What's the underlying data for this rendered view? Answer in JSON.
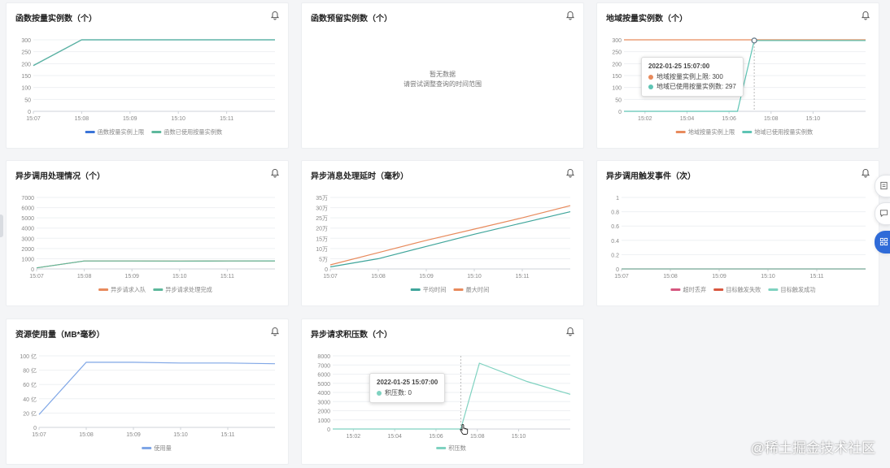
{
  "common": {
    "bell_icon": "bell-icon"
  },
  "side_toolbar": {
    "icons": [
      "document-icon",
      "chat-icon",
      "grid-icon"
    ]
  },
  "watermark": "@稀土掘金技术社区",
  "cards": [
    {
      "title": "函数按量实例数（个）",
      "chart_data": {
        "type": "line",
        "y_ticks": [
          "0",
          "50",
          "100",
          "150",
          "200",
          "250",
          "300"
        ],
        "ylim": [
          0,
          300
        ],
        "x_ticks": [
          "15:07",
          "15:08",
          "15:09",
          "15:10",
          "15:11"
        ],
        "x_tick_pos": [
          0,
          1,
          2,
          3,
          4
        ],
        "xlim": [
          0,
          5
        ],
        "series": [
          {
            "name": "函数按量实例上限",
            "color": "#3a74d8",
            "x": [
              0,
              1,
              2,
              3,
              4,
              5
            ],
            "y": [
              192,
              300,
              300,
              300,
              300,
              300
            ]
          },
          {
            "name": "函数已使用按量实例数",
            "color": "#5db89c",
            "x": [
              0,
              1,
              2,
              3,
              4,
              5
            ],
            "y": [
              192,
              300,
              300,
              300,
              300,
              300
            ]
          }
        ]
      }
    },
    {
      "title": "函数预留实例数（个）",
      "empty_line1": "暂无数据",
      "empty_line2": "请尝试调整查询的时间范围"
    },
    {
      "title": "地域按量实例数（个）",
      "chart_data": {
        "type": "line",
        "y_ticks": [
          "0",
          "50",
          "100",
          "150",
          "200",
          "250",
          "300"
        ],
        "ylim": [
          0,
          300
        ],
        "x_ticks": [
          "15:02",
          "15:04",
          "15:06",
          "15:08",
          "15:10"
        ],
        "x_tick_pos": [
          1,
          3,
          5,
          7,
          9
        ],
        "xlim": [
          0,
          11.5
        ],
        "hover_x": 6.2,
        "series": [
          {
            "name": "地域按量实例上限",
            "color": "#e88a5c",
            "x": [
              0,
              6.2,
              11.5
            ],
            "y": [
              300,
              300,
              300
            ]
          },
          {
            "name": "地域已使用按量实例数",
            "color": "#5ec4b4",
            "x": [
              0,
              5.2,
              5.4,
              6.2,
              11.5
            ],
            "y": [
              0,
              0,
              0,
              297,
              297
            ]
          }
        ]
      },
      "tooltip": {
        "title": "2022-01-25 15:07:00",
        "rows": [
          {
            "label": "地域按量实例上限: 300",
            "color": "#e88a5c"
          },
          {
            "label": "地域已使用按量实例数: 297",
            "color": "#5ec4b4"
          }
        ]
      }
    },
    {
      "title": "异步调用处理情况（个）",
      "chart_data": {
        "type": "line",
        "y_ticks": [
          "0",
          "1000",
          "2000",
          "3000",
          "4000",
          "5000",
          "6000",
          "7000"
        ],
        "ylim": [
          0,
          7000
        ],
        "x_ticks": [
          "15:07",
          "15:08",
          "15:09",
          "15:10",
          "15:11"
        ],
        "x_tick_pos": [
          0,
          1,
          2,
          3,
          4
        ],
        "xlim": [
          0,
          5
        ],
        "series": [
          {
            "name": "异步请求入队",
            "color": "#e88a5c",
            "x": [
              0,
              1,
              2,
              3,
              4,
              5
            ],
            "y": [
              100,
              780,
              780,
              770,
              780,
              790
            ]
          },
          {
            "name": "异步请求处理完成",
            "color": "#5db89c",
            "x": [
              0,
              1,
              2,
              3,
              4,
              5
            ],
            "y": [
              100,
              780,
              780,
              770,
              780,
              790
            ]
          }
        ]
      }
    },
    {
      "title": "异步消息处理延时（毫秒）",
      "chart_data": {
        "type": "line",
        "y_ticks": [
          "0",
          "5万",
          "10万",
          "15万",
          "20万",
          "25万",
          "30万",
          "35万"
        ],
        "ylim": [
          0,
          350000
        ],
        "x_ticks": [
          "15:07",
          "15:08",
          "15:09",
          "15:10",
          "15:11"
        ],
        "x_tick_pos": [
          0,
          1,
          2,
          3,
          4
        ],
        "xlim": [
          0,
          5
        ],
        "series": [
          {
            "name": "平均时间",
            "color": "#3fa59b",
            "x": [
              0,
              1,
              2,
              3,
              4,
              5
            ],
            "y": [
              10000,
              50000,
              110000,
              170000,
              225000,
              280000
            ]
          },
          {
            "name": "最大时间",
            "color": "#e88a5c",
            "x": [
              0,
              1,
              2,
              3,
              4,
              5
            ],
            "y": [
              20000,
              80000,
              140000,
              195000,
              250000,
              310000
            ]
          }
        ]
      }
    },
    {
      "title": "异步调用触发事件（次）",
      "chart_data": {
        "type": "line",
        "y_ticks": [
          "0",
          "0.2",
          "0.4",
          "0.6",
          "0.8",
          "1"
        ],
        "ylim": [
          0,
          1
        ],
        "x_ticks": [
          "15:07",
          "15:08",
          "15:09",
          "15:10",
          "15:11"
        ],
        "x_tick_pos": [
          0,
          1,
          2,
          3,
          4
        ],
        "xlim": [
          0,
          5
        ],
        "series": [
          {
            "name": "超时丢弃",
            "color": "#d5577f",
            "x": [
              0,
              5
            ],
            "y": [
              0,
              0
            ]
          },
          {
            "name": "目标触发失败",
            "color": "#d9573f",
            "x": [
              0,
              5
            ],
            "y": [
              0,
              0
            ]
          },
          {
            "name": "目标触发成功",
            "color": "#7fd2c0",
            "x": [
              0,
              5
            ],
            "y": [
              0,
              0
            ]
          }
        ]
      }
    },
    {
      "title": "资源使用量（MB*毫秒）",
      "chart_data": {
        "type": "line",
        "y_ticks": [
          "0",
          "20 亿",
          "40 亿",
          "60 亿",
          "80 亿",
          "100 亿"
        ],
        "ylim": [
          0,
          100
        ],
        "x_ticks": [
          "15:07",
          "15:08",
          "15:09",
          "15:10",
          "15:11"
        ],
        "x_tick_pos": [
          0,
          1,
          2,
          3,
          4
        ],
        "xlim": [
          0,
          5
        ],
        "series": [
          {
            "name": "使用量",
            "color": "#7fa6e6",
            "x": [
              0,
              1,
              2,
              3,
              4,
              5
            ],
            "y": [
              18,
              91,
              91,
              90,
              90,
              89
            ]
          }
        ]
      }
    },
    {
      "title": "异步请求积压数（个）",
      "chart_data": {
        "type": "line",
        "y_ticks": [
          "0",
          "1000",
          "2000",
          "3000",
          "4000",
          "5000",
          "6000",
          "7000",
          "8000"
        ],
        "ylim": [
          0,
          8000
        ],
        "x_ticks": [
          "15:02",
          "15:04",
          "15:06",
          "15:08",
          "15:10"
        ],
        "x_tick_pos": [
          1,
          3,
          5,
          7,
          9
        ],
        "xlim": [
          0,
          11.5
        ],
        "hover_x": 6.2,
        "series": [
          {
            "name": "积压数",
            "color": "#7fd2c0",
            "x": [
              0,
              6.2,
              7.1,
              9.4,
              11.5
            ],
            "y": [
              0,
              0,
              7200,
              5200,
              3800
            ]
          }
        ]
      },
      "tooltip": {
        "title": "2022-01-25 15:07:00",
        "rows": [
          {
            "label": "积压数: 0",
            "color": "#7fd2c0"
          }
        ]
      }
    }
  ]
}
